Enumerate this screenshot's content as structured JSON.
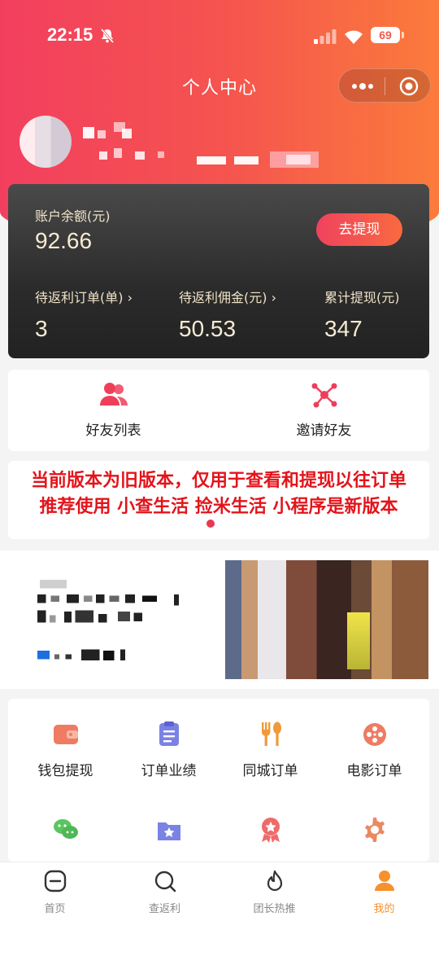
{
  "status_bar": {
    "time": "22:15",
    "battery": "69"
  },
  "nav": {
    "title": "个人中心"
  },
  "account": {
    "balance_label": "账户余额(元)",
    "balance_value": "92.66",
    "withdraw_label": "去提现",
    "stats": [
      {
        "label": "待返利订单(单) ›",
        "value": "3"
      },
      {
        "label": "待返利佣金(元) ›",
        "value": "50.53"
      },
      {
        "label": "累计提现(元)",
        "value": "347"
      }
    ]
  },
  "friends": {
    "list_label": "好友列表",
    "invite_label": "邀请好友"
  },
  "notice": {
    "line1": "当前版本为旧版本，仅用于查看和提现以往订单",
    "line2": "推荐使用 小查生活 捡米生活 小程序是新版本"
  },
  "services": [
    {
      "label": "钱包提现",
      "icon": "wallet-icon"
    },
    {
      "label": "订单业绩",
      "icon": "clipboard-icon"
    },
    {
      "label": "同城订单",
      "icon": "fork-spoon-icon"
    },
    {
      "label": "电影订单",
      "icon": "film-reel-icon"
    },
    {
      "label": "",
      "icon": "wechat-icon"
    },
    {
      "label": "",
      "icon": "star-folder-icon"
    },
    {
      "label": "",
      "icon": "badge-icon"
    },
    {
      "label": "",
      "icon": "gear-icon"
    }
  ],
  "tabbar": {
    "items": [
      {
        "label": "首页",
        "icon": "home-icon"
      },
      {
        "label": "查返利",
        "icon": "search-icon"
      },
      {
        "label": "团长热推",
        "icon": "flame-icon"
      },
      {
        "label": "我的",
        "icon": "profile-icon"
      }
    ],
    "active_index": 3
  },
  "colors": {
    "brand_red": "#f23f5f",
    "brand_orange": "#fb7b3b",
    "notice_red": "#e3141b",
    "tab_active": "#f6912d"
  }
}
